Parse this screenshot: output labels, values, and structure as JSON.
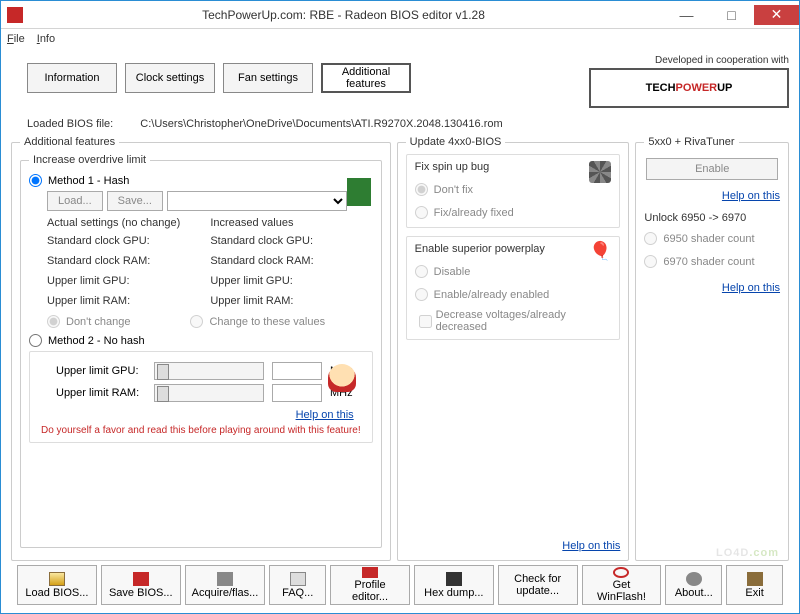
{
  "window": {
    "title": "TechPowerUp.com: RBE - Radeon BIOS editor v1.28"
  },
  "menu": {
    "file": "File",
    "info": "Info"
  },
  "tabs": {
    "information": "Information",
    "clock": "Clock settings",
    "fan": "Fan settings",
    "additional": "Additional features"
  },
  "coop": {
    "label": "Developed in cooperation with",
    "logo_tech": "TECH",
    "logo_power": "POWER",
    "logo_up": "UP"
  },
  "loaded": {
    "label": "Loaded BIOS file:",
    "path": "C:\\Users\\Christopher\\OneDrive\\Documents\\ATI.R9270X.2048.130416.rom"
  },
  "addfeat": {
    "legend": "Additional features",
    "overdrive": {
      "legend": "Increase overdrive limit",
      "method1": "Method 1 - Hash",
      "load": "Load...",
      "save": "Save...",
      "actual_hdr": "Actual settings (no change)",
      "increased_hdr": "Increased values",
      "std_gpu": "Standard clock GPU:",
      "std_ram": "Standard clock RAM:",
      "up_gpu": "Upper limit GPU:",
      "up_ram": "Upper limit RAM:",
      "dont_change": "Don't change",
      "change_to": "Change to these values",
      "method2": "Method 2 - No hash",
      "mhz": "MHz",
      "help": "Help on this",
      "warn": "Do yourself a favor and read this before playing around with this feature!"
    }
  },
  "update": {
    "legend": "Update 4xx0-BIOS",
    "spin": {
      "title": "Fix spin up bug",
      "dont": "Don't fix",
      "fix": "Fix/already fixed"
    },
    "power": {
      "title": "Enable superior powerplay",
      "disable": "Disable",
      "enable": "Enable/already enabled",
      "decrease": "Decrease voltages/already decreased"
    },
    "help": "Help on this"
  },
  "riva": {
    "legend": "5xx0 + RivaTuner",
    "enable": "Enable",
    "help": "Help on this",
    "unlock": "Unlock 6950 -> 6970",
    "r6950": "6950 shader count",
    "r6970": "6970 shader count",
    "help2": "Help on this"
  },
  "bottom": {
    "load": "Load BIOS...",
    "save": "Save BIOS...",
    "acquire": "Acquire/flas...",
    "faq": "FAQ...",
    "profile": "Profile editor...",
    "hex": "Hex dump...",
    "check": "Check for update...",
    "winflash": "Get WinFlash!",
    "about": "About...",
    "exit": "Exit"
  },
  "watermark": {
    "text": "LO4D",
    "ext": ".com"
  }
}
